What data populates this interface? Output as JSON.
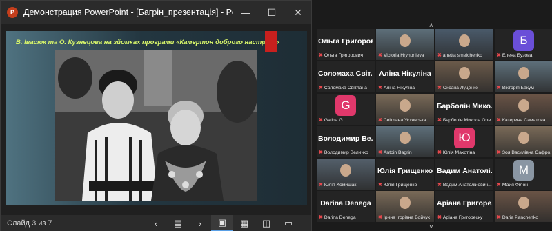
{
  "window": {
    "title": "Демонстрация PowerPoint - [Багрін_презентація] - PowerPoint",
    "app_icon": "powerpoint-icon"
  },
  "slide": {
    "caption": "В. Івасюк та О. Кузнецова на зйомках програми «Камертон доброго настрою»"
  },
  "statusbar": {
    "slide_count": "Слайд 3 из 7"
  },
  "participants": [
    {
      "big": "Ольга Григоров...",
      "name": "Ольга Григорович"
    },
    {
      "video": true,
      "name": "Victoria Hryhoriieva"
    },
    {
      "video": true,
      "name": "anetta smelchenko"
    },
    {
      "avatar": "Б",
      "color": "#6a4fd8",
      "name": "Елена Бузова"
    },
    {
      "big": "Соломаха Світ...",
      "name": "Соломаха Світлана"
    },
    {
      "big": "Аліна Нікуліна",
      "name": "Аліна Нікуліна"
    },
    {
      "video": true,
      "name": "Оксана Луценко"
    },
    {
      "video": true,
      "name": "Вікторія Бакум"
    },
    {
      "avatar": "G",
      "color": "#e0386b",
      "name": "Galina G"
    },
    {
      "video": true,
      "name": "Світлана Устянська"
    },
    {
      "big": "Барболін Мико...",
      "name": "Барболін Микола Оле..."
    },
    {
      "video": true,
      "name": "Катерина Саматова"
    },
    {
      "big": "Володимир Ве...",
      "name": "Володимир Величко"
    },
    {
      "video": true,
      "name": "Antoin Bagrin",
      "speaking": true
    },
    {
      "avatar": "Ю",
      "color": "#e0386b",
      "name": "Юлія Махотіна"
    },
    {
      "video": true,
      "name": "Зоя Василівна Сафро..."
    },
    {
      "video": true,
      "name": "Юлія Хомишак"
    },
    {
      "big": "Юлія Грищенко",
      "name": "Юлія Грищенко"
    },
    {
      "big": "Вадим Анатолі...",
      "name": "Вадим Анатолійович..."
    },
    {
      "avatar": "М",
      "color": "#8a96a3",
      "name": "Майя Філон"
    },
    {
      "big": "Darina Denega",
      "name": "Darina Denega"
    },
    {
      "video": true,
      "name": "Ірина Ігорівна Бойчук"
    },
    {
      "big": "Аріана Григоре...",
      "name": "Аріана Григореску"
    },
    {
      "video": true,
      "name": "Daria Panchenko"
    }
  ]
}
